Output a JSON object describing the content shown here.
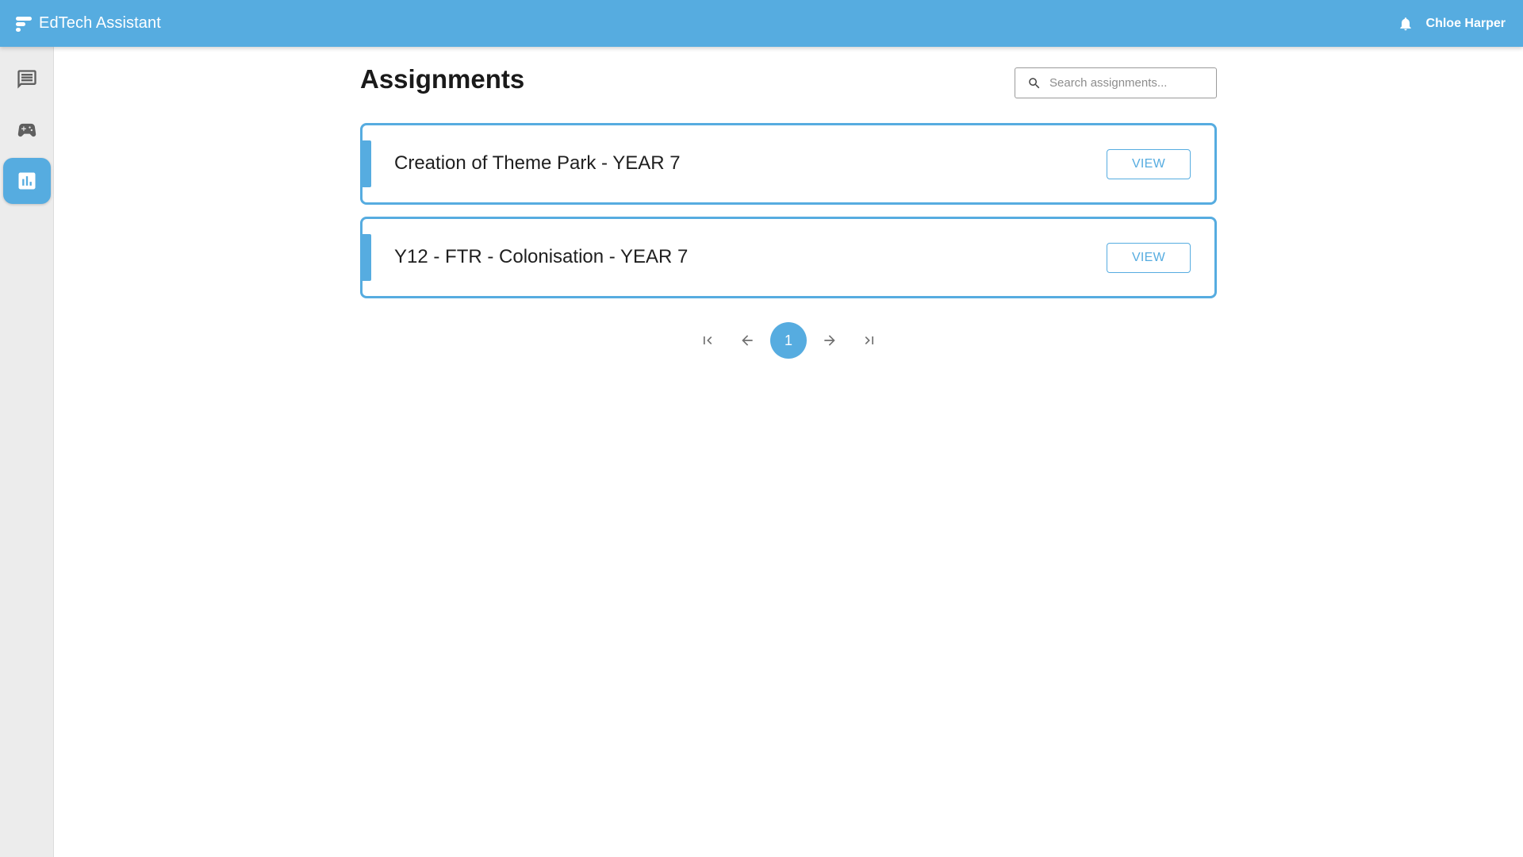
{
  "app": {
    "title": "EdTech Assistant"
  },
  "header": {
    "user_name": "Chloe Harper"
  },
  "sidebar": {
    "items": [
      {
        "icon": "chat-icon",
        "active": false
      },
      {
        "icon": "gamepad-icon",
        "active": false
      },
      {
        "icon": "chart-icon",
        "active": true
      }
    ]
  },
  "page": {
    "title": "Assignments",
    "search_placeholder": "Search assignments..."
  },
  "assignments": [
    {
      "title": "Creation of Theme Park - YEAR 7",
      "action": "VIEW"
    },
    {
      "title": "Y12 - FTR - Colonisation - YEAR 7",
      "action": "VIEW"
    }
  ],
  "pagination": {
    "current_page": "1"
  },
  "colors": {
    "accent": "#56ace0",
    "sidebar_bg": "#ececec",
    "icon_gray": "#5f5f5f"
  }
}
